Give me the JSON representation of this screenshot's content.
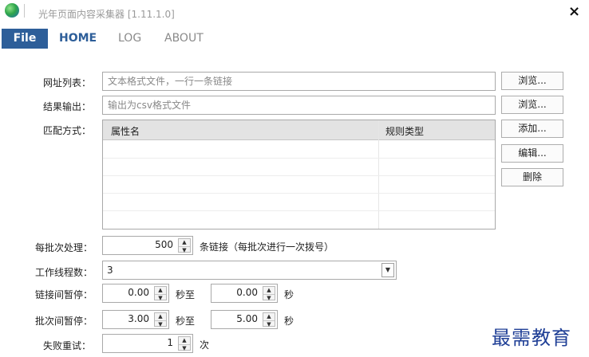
{
  "app": {
    "title": "光年页面内容采集器 [1.11.1.0]",
    "logo_icon": "green-blue-sphere-icon",
    "close_icon": "close-icon",
    "close_glyph": "×"
  },
  "menu": {
    "file": "File",
    "home": "HOME",
    "log": "LOG",
    "about": "ABOUT"
  },
  "form": {
    "url_list": {
      "label": "网址列表：",
      "placeholder": "文本格式文件，一行一条链接",
      "browse": "浏览..."
    },
    "result_output": {
      "label": "结果输出：",
      "placeholder": "输出为csv格式文件",
      "browse": "浏览..."
    },
    "match_mode": {
      "label": "匹配方式：",
      "columns": [
        "属性名",
        "规则类型"
      ],
      "rows": [],
      "add": "添加...",
      "edit": "编辑...",
      "delete": "删除"
    },
    "batch_process": {
      "label": "每批次处理：",
      "value": "500",
      "unit": "条链接（每批次进行一次拨号）"
    },
    "threads": {
      "label": "工作线程数：",
      "value": "3"
    },
    "link_pause": {
      "label": "链接间暂停：",
      "from": "0.00",
      "mid": "秒至",
      "to": "0.00",
      "unit": "秒"
    },
    "batch_pause": {
      "label": "批次间暂停：",
      "from": "3.00",
      "mid": "秒至",
      "to": "5.00",
      "unit": "秒"
    },
    "retry": {
      "label": "失败重试：",
      "value": "1",
      "unit": "次"
    }
  },
  "watermark": "最需教育",
  "colors": {
    "menu_file_bg": "#2d5e99",
    "active_tab": "#2d5e99",
    "watermark": "#1f3f96"
  }
}
